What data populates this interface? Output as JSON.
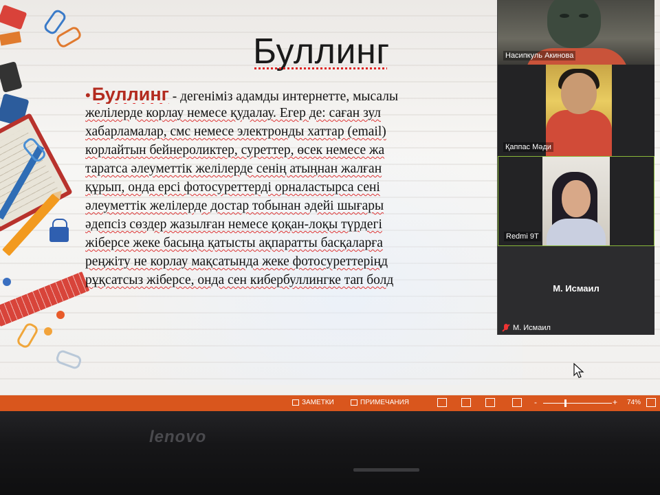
{
  "slide": {
    "title": "Буллинг",
    "bullet": "•",
    "term": "Буллинг",
    "lines": [
      " - дегеніміз адамды интернетте, мысалы ",
      "желілерде корлау немесе қудалау. Егер де: саған зул",
      "хабарламалар, смс немесе электронды хаттар (email)",
      "корлайтын бейнероликтер, суреттер, өсек немесе жа",
      "таратса әлеуметтік желілерде сенің атыңнан жалған ",
      "құрып, онда ерсі фотосуреттерді орналастырса  сені",
      "әлеуметтік желілерде достар тобынан әдейі шығары",
      "әдепсіз сөздер жазылған немесе қоқан-лоқы түрдегі ",
      "жіберсе жеке басыңа қатысты ақпаратты басқаларға",
      "реңжіту не корлау мақсатында жеке фотосуреттеріңд",
      "рұқсатсыз жіберсе, онда сен кибербуллингке тап болд"
    ]
  },
  "participants": [
    {
      "name": "Насипкуль Акинова"
    },
    {
      "name": "Қаппас Мәди"
    },
    {
      "name": "Redmi 9T"
    },
    {
      "name": "М. Исмаил"
    }
  ],
  "statusbar": {
    "notes_label": "ЗАМЕТКИ",
    "comments_label": "ПРИМЕЧАНИЯ",
    "zoom_minus": "-",
    "zoom_plus": "+",
    "zoom_level": "74%",
    "zoom_value": 0.32
  },
  "laptop": {
    "brand": "lenovo"
  }
}
